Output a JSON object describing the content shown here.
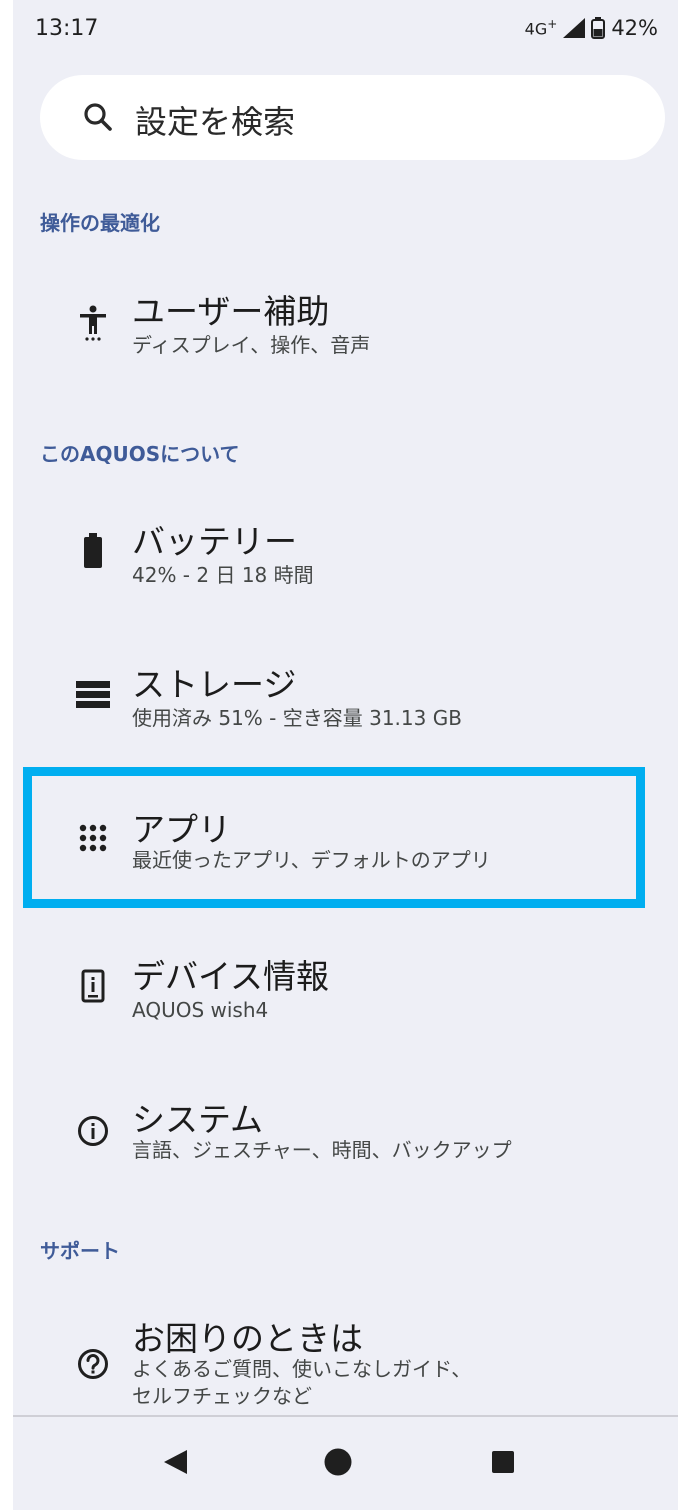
{
  "status_bar": {
    "time": "13:17",
    "network": "4G",
    "network_sup": "+",
    "battery_percent": "42%"
  },
  "search": {
    "placeholder": "設定を検索"
  },
  "sections": [
    {
      "header": "操作の最適化",
      "items": [
        {
          "title": "ユーザー補助",
          "subtitle": "ディスプレイ、操作、音声",
          "icon": "accessibility-icon"
        }
      ]
    },
    {
      "header": "このAQUOSについて",
      "items": [
        {
          "title": "バッテリー",
          "subtitle": "42% - 2 日 18 時間",
          "icon": "battery-icon"
        },
        {
          "title": "ストレージ",
          "subtitle": "使用済み 51% - 空き容量 31.13 GB",
          "icon": "storage-icon"
        },
        {
          "title": "アプリ",
          "subtitle": "最近使ったアプリ、デフォルトのアプリ",
          "icon": "apps-grid-icon",
          "highlighted": true
        },
        {
          "title": "デバイス情報",
          "subtitle": "AQUOS wish4",
          "icon": "device-info-icon"
        },
        {
          "title": "システム",
          "subtitle": "言語、ジェスチャー、時間、バックアップ",
          "icon": "info-icon"
        }
      ]
    },
    {
      "header": "サポート",
      "items": [
        {
          "title": "お困りのときは",
          "subtitle_lines": [
            "よくあるご質問、使いこなしガイド、",
            "セルフチェックなど"
          ],
          "icon": "help-icon"
        }
      ]
    }
  ],
  "nav_bar": {
    "back": "back-icon",
    "home": "home-icon",
    "recents": "recents-icon"
  },
  "colors": {
    "background": "#eeeff6",
    "section_header": "#3f5b98",
    "highlight": "#00aef0"
  }
}
